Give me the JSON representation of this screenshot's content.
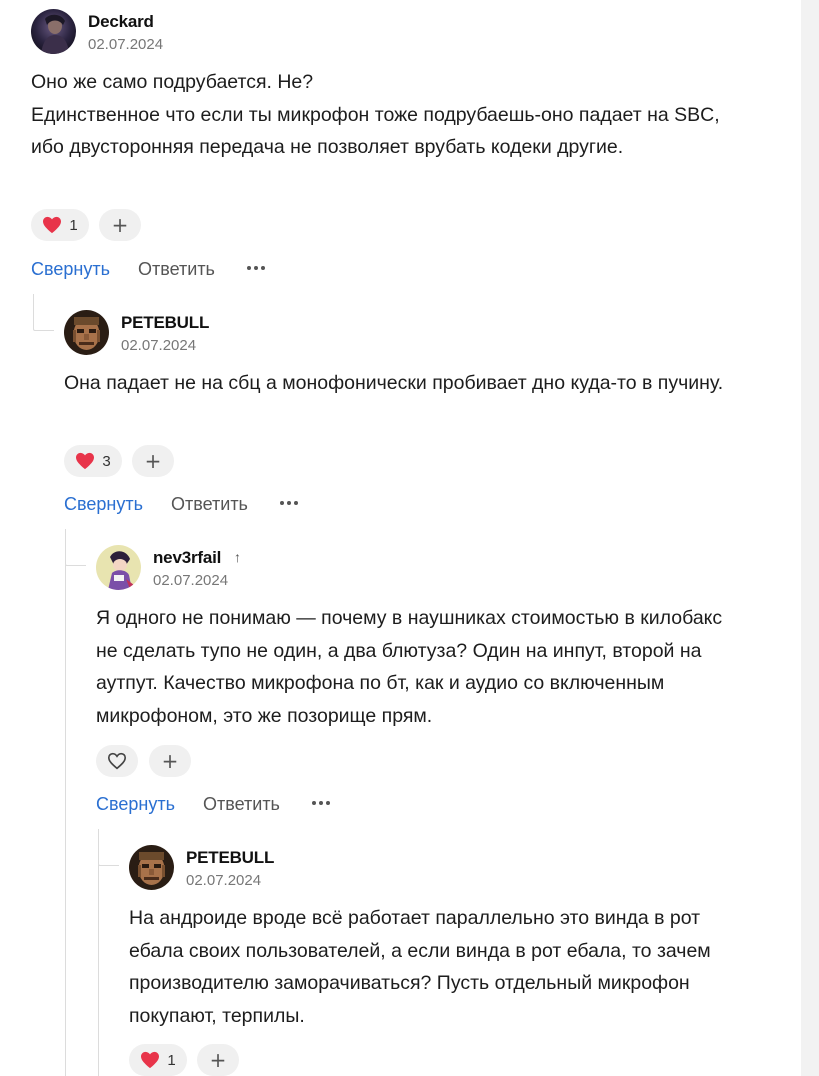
{
  "comments": [
    {
      "author": "Deckard",
      "date": "02.07.2024",
      "avatar_icon": "dark-figure-avatar",
      "text": [
        "Оно же само подрубается. Не?",
        "Единственное что если ты микрофон тоже подрубаешь-оно падает на SBC, ибо двусторонняя передача не позволяет врубать кодеки другие."
      ],
      "likes": "1",
      "liked": true,
      "collapse_label": "Свернуть",
      "reply_label": "Ответить"
    },
    {
      "author": "PETEBULL",
      "date": "02.07.2024",
      "avatar_icon": "doom-face-avatar",
      "text": [
        "Она падает не на сбц а монофонически пробивает дно куда-то в пучину."
      ],
      "likes": "3",
      "liked": true,
      "collapse_label": "Свернуть",
      "reply_label": "Ответить"
    },
    {
      "author": "nev3rfail",
      "author_badge": "↑",
      "date": "02.07.2024",
      "avatar_icon": "anime-character-avatar",
      "text": [
        "Я одного не понимаю — почему в наушниках стоимостью в килобакс не сделать тупо не один, а два блютуза? Один на инпут, второй на аутпут. Качество микрофона по бт, как и аудио со включенным микрофоном, это же позорище прям."
      ],
      "likes": "",
      "liked": false,
      "collapse_label": "Свернуть",
      "reply_label": "Ответить"
    },
    {
      "author": "PETEBULL",
      "date": "02.07.2024",
      "avatar_icon": "doom-face-avatar",
      "text": [
        "На андроиде вроде всё работает параллельно это винда в рот ебала своих пользователей, а если винда в рот ебала, то зачем производителю заморачиваться? Пусть отдельный микрофон покупают, терпилы."
      ],
      "likes": "1",
      "liked": true
    }
  ],
  "icons": {
    "heart": "heart-icon",
    "heart_outline": "heart-outline-icon",
    "plus": "+",
    "more": "more-dots-icon"
  },
  "colors": {
    "link_blue": "#2a6fd1",
    "heart_red": "#e8344a",
    "pill_bg": "#f0f0f0"
  }
}
